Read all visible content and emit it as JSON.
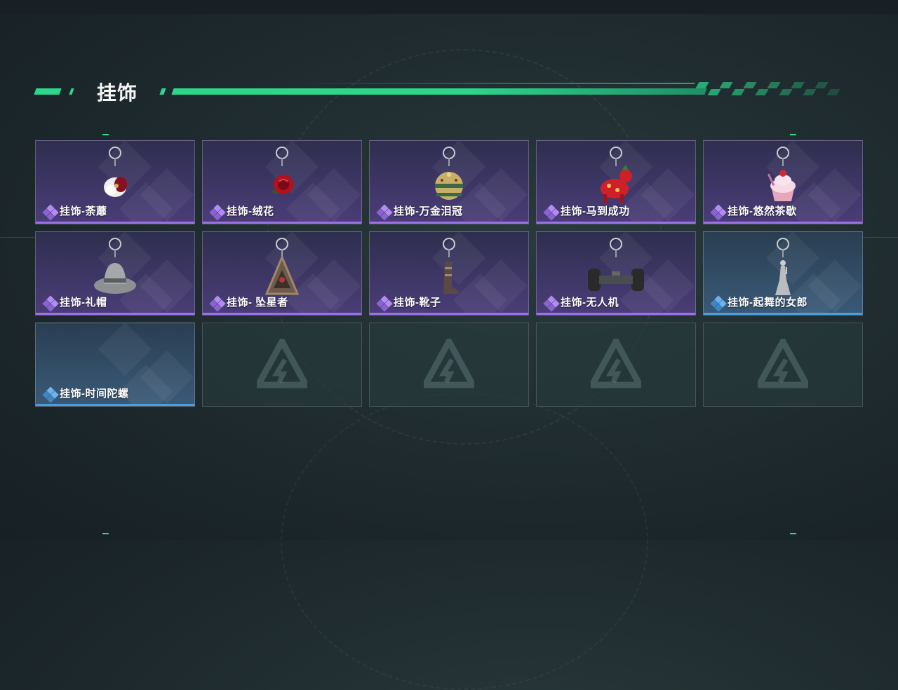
{
  "page": {
    "title": "挂饰"
  },
  "colors": {
    "accent": "#2ed68c",
    "rarity_purple": "#9b72e6",
    "rarity_blue": "#4c9ed8"
  },
  "cards": [
    {
      "name": "挂饰-荼蘼",
      "rarity": "purple",
      "icon": "white-flower-charm-icon"
    },
    {
      "name": "挂饰-绒花",
      "rarity": "purple",
      "icon": "red-rose-charm-icon"
    },
    {
      "name": "挂饰-万金泪冠",
      "rarity": "purple",
      "icon": "golden-crown-charm-icon"
    },
    {
      "name": "挂饰-马到成功",
      "rarity": "purple",
      "icon": "red-horse-charm-icon"
    },
    {
      "name": "挂饰-悠然茶歇",
      "rarity": "purple",
      "icon": "cupcake-charm-icon"
    },
    {
      "name": "挂饰-礼帽",
      "rarity": "purple",
      "icon": "hat-charm-icon"
    },
    {
      "name": "挂饰- 坠星者",
      "rarity": "purple",
      "icon": "triangle-pendant-charm-icon"
    },
    {
      "name": "挂饰-靴子",
      "rarity": "purple",
      "icon": "boot-charm-icon"
    },
    {
      "name": "挂饰-无人机",
      "rarity": "purple",
      "icon": "drone-wheels-charm-icon"
    },
    {
      "name": "挂饰-起舞的女郎",
      "rarity": "blue",
      "icon": "dancer-figurine-charm-icon"
    },
    {
      "name": "挂饰-时间陀螺",
      "rarity": "blue",
      "icon": ""
    },
    {
      "name": "",
      "rarity": "empty",
      "icon": "game-logo-icon"
    },
    {
      "name": "",
      "rarity": "empty",
      "icon": "game-logo-icon"
    },
    {
      "name": "",
      "rarity": "empty",
      "icon": "game-logo-icon"
    },
    {
      "name": "",
      "rarity": "empty",
      "icon": "game-logo-icon"
    }
  ]
}
